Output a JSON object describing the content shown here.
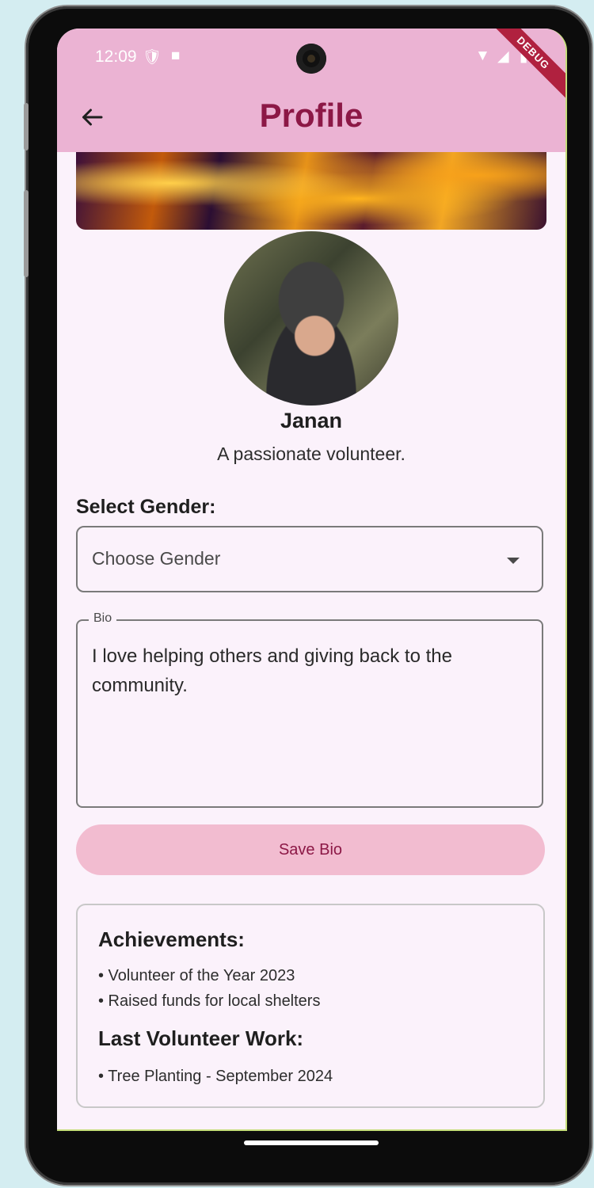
{
  "status_bar": {
    "time": "12:09",
    "debug_banner": "DEBUG"
  },
  "appbar": {
    "title": "Profile",
    "back_icon": "arrow-left-icon"
  },
  "profile": {
    "name": "Janan",
    "tagline": "A passionate volunteer."
  },
  "gender": {
    "label": "Select Gender:",
    "placeholder": "Choose Gender"
  },
  "bio": {
    "label": "Bio",
    "value": "I love helping others and giving back to the community."
  },
  "save_button": {
    "label": "Save Bio"
  },
  "achievements": {
    "heading": "Achievements:",
    "items": [
      "• Volunteer of the Year 2023",
      "• Raised funds for local shelters"
    ]
  },
  "last_work": {
    "heading": "Last Volunteer Work:",
    "items": [
      "• Tree Planting - September 2024"
    ]
  },
  "colors": {
    "appbar_bg": "#ebb3d3",
    "title": "#8c1846",
    "button_bg": "#f2bcd0",
    "background": "#fbf2fb"
  }
}
